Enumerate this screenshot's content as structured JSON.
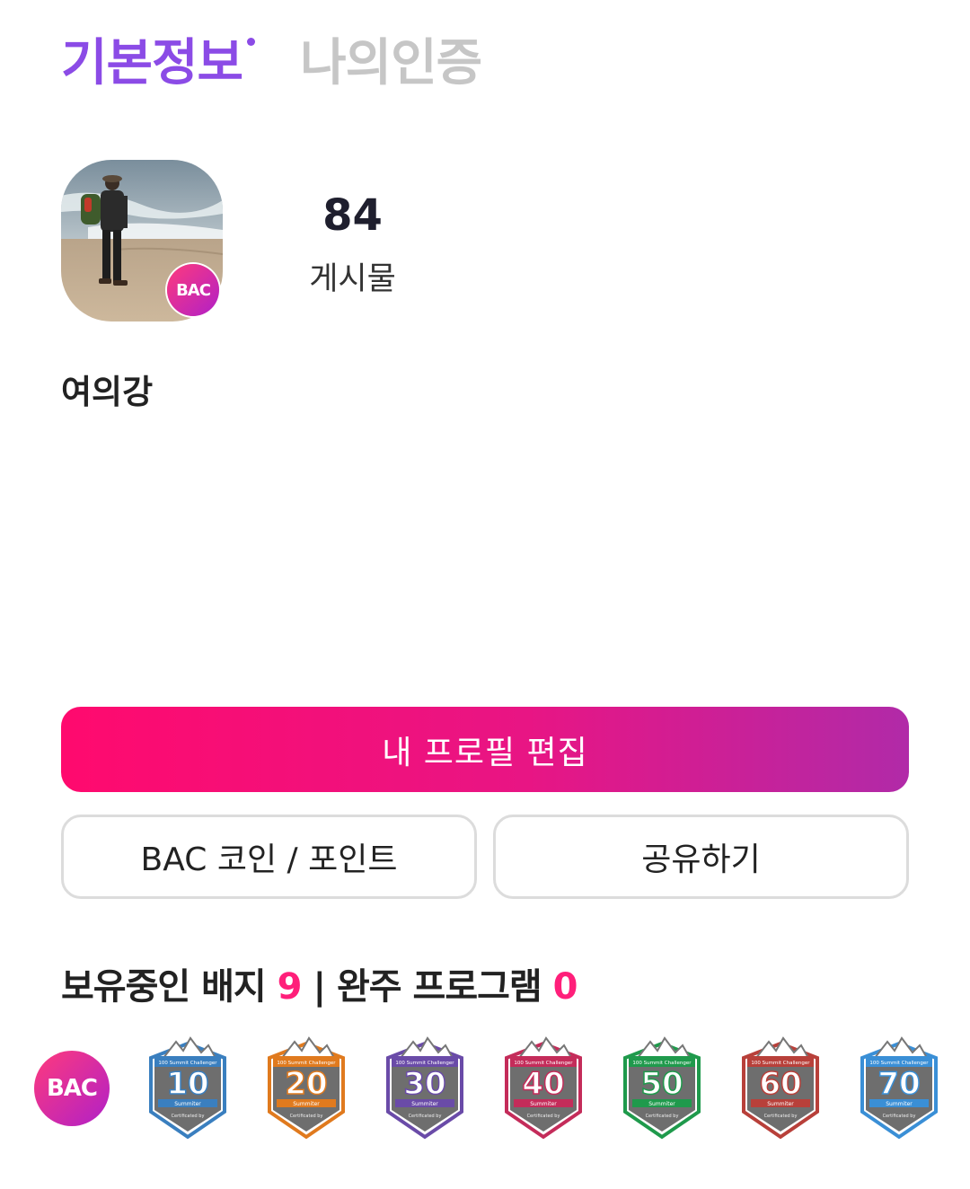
{
  "tabs": {
    "active": "기본정보",
    "inactive": "나의인증"
  },
  "profile": {
    "badge_text": "BAC",
    "posts_count": "84",
    "posts_label": "게시물",
    "username": "여의강"
  },
  "buttons": {
    "edit": "내 프로필 편집",
    "coin": "BAC 코인 / 포인트",
    "share": "공유하기"
  },
  "badges_section": {
    "label_badges": "보유중인 배지",
    "badge_count": "9",
    "separator": "|",
    "label_programs": "완주 프로그램",
    "program_count": "0"
  },
  "badge_items": [
    {
      "type": "bac",
      "text": "BAC"
    },
    {
      "number": "10",
      "color": "#3a7fbf",
      "header": "100 Summit Challenger",
      "sub": "Summiter",
      "footer": "Certificated by"
    },
    {
      "number": "20",
      "color": "#e07a1e",
      "header": "100 Summit Challenger",
      "sub": "Summiter",
      "footer": "Certificated by"
    },
    {
      "number": "30",
      "color": "#6a4ba8",
      "header": "100 Summit Challenger",
      "sub": "Summiter",
      "footer": "Certificated by"
    },
    {
      "number": "40",
      "color": "#c42c5a",
      "header": "100 Summit Challenger",
      "sub": "Summiter",
      "footer": "Certificated by"
    },
    {
      "number": "50",
      "color": "#1f9a4c",
      "header": "100 Summit Challenger",
      "sub": "Summiter",
      "footer": "Certificated by"
    },
    {
      "number": "60",
      "color": "#b8403a",
      "header": "100 Summit Challenger",
      "sub": "Summiter",
      "footer": "Certificated by"
    },
    {
      "number": "70",
      "color": "#3a8fd6",
      "header": "100 Summit Challenger",
      "sub": "Summiter",
      "footer": "Certificated by"
    }
  ],
  "colors": {
    "tab_active": "#8b4be6",
    "tab_inactive": "#c6c6c6",
    "accent_pink": "#ff1f7a",
    "gradient_start": "#ff0a6e",
    "gradient_end": "#b12aa8"
  }
}
